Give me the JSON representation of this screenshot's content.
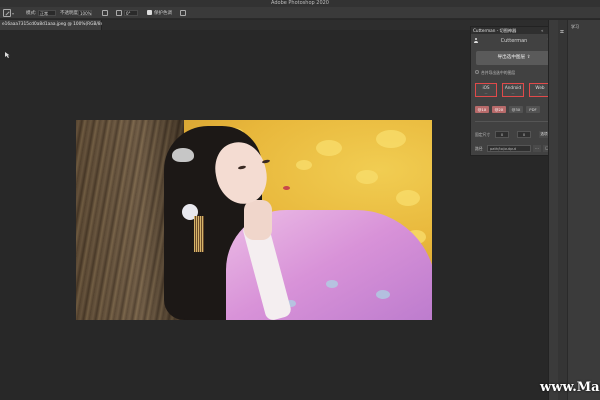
{
  "app": {
    "window_title": "Adobe Photoshop 2020"
  },
  "options_bar": {
    "mode_label": "模式:",
    "mode_value": "正常",
    "opacity_label": "不透明度:",
    "opacity_value": "100%",
    "flow_value": "0°",
    "protect_tones_label": "保护色调",
    "protect_tones_checked": true
  },
  "document": {
    "tab_title": "e16aaa7315cd0a8d1aaa.jpeg @ 100%(RGB/8#)"
  },
  "cutterman_panel": {
    "title": "Cutterman - 切图神器",
    "brand": "Cutterman",
    "export_button": "导出选中图层",
    "radio_label": "合并导出选中的图层",
    "platforms": [
      {
        "label": "iOS",
        "sub": "—"
      },
      {
        "label": "Android",
        "sub": "—"
      },
      {
        "label": "Web",
        "sub": "—"
      }
    ],
    "scales": [
      {
        "label": "@1X",
        "active": true
      },
      {
        "label": "@2X",
        "active": true
      },
      {
        "label": "@3X",
        "active": false
      },
      {
        "label": "PDF",
        "active": false
      }
    ],
    "size_label": "固定尺寸",
    "size_w": "0",
    "size_h": "0",
    "size_btn": "选项",
    "path_label": "路径",
    "path_value": "path/to/output",
    "path_menu": "...",
    "path_btn": "□"
  },
  "right_panel": {
    "tab_label": "学习"
  },
  "watermark": "www.Mac"
}
